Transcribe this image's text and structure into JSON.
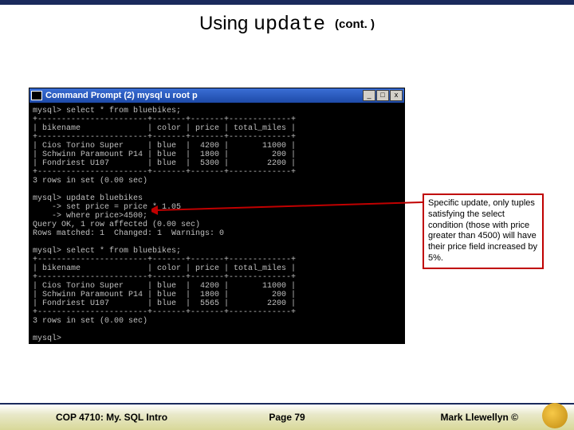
{
  "title": {
    "prefix": "Using ",
    "code": "update",
    "cont": "(cont. )"
  },
  "terminal": {
    "windowTitle": "Command Prompt (2)   mysql  u root  p",
    "buttons": {
      "min": "_",
      "max": "□",
      "close": "x"
    },
    "content": "mysql> select * from bluebikes;\n+-----------------------+-------+-------+-------------+\n| bikename              | color | price | total_miles |\n+-----------------------+-------+-------+-------------+\n| Cios Torino Super     | blue  |  4200 |       11000 |\n| Schwinn Paramount P14 | blue  |  1800 |         200 |\n| Fondriest U107        | blue  |  5300 |        2200 |\n+-----------------------+-------+-------+-------------+\n3 rows in set (0.00 sec)\n\nmysql> update bluebikes\n    -> set price = price * 1.05\n    -> where price>4500;\nQuery OK, 1 row affected (0.00 sec)\nRows matched: 1  Changed: 1  Warnings: 0\n\nmysql> select * from bluebikes;\n+-----------------------+-------+-------+-------------+\n| bikename              | color | price | total_miles |\n+-----------------------+-------+-------+-------------+\n| Cios Torino Super     | blue  |  4200 |       11000 |\n| Schwinn Paramount P14 | blue  |  1800 |         200 |\n| Fondriest U107        | blue  |  5565 |        2200 |\n+-----------------------+-------+-------+-------------+\n3 rows in set (0.00 sec)\n\nmysql>"
  },
  "annotation": "Specific update, only tuples satisfying the select condition (those with price greater than 4500) will have their price field increased by 5%.",
  "footer": {
    "course": "COP 4710: My. SQL Intro",
    "page": "Page 79",
    "author": "Mark Llewellyn ©"
  }
}
